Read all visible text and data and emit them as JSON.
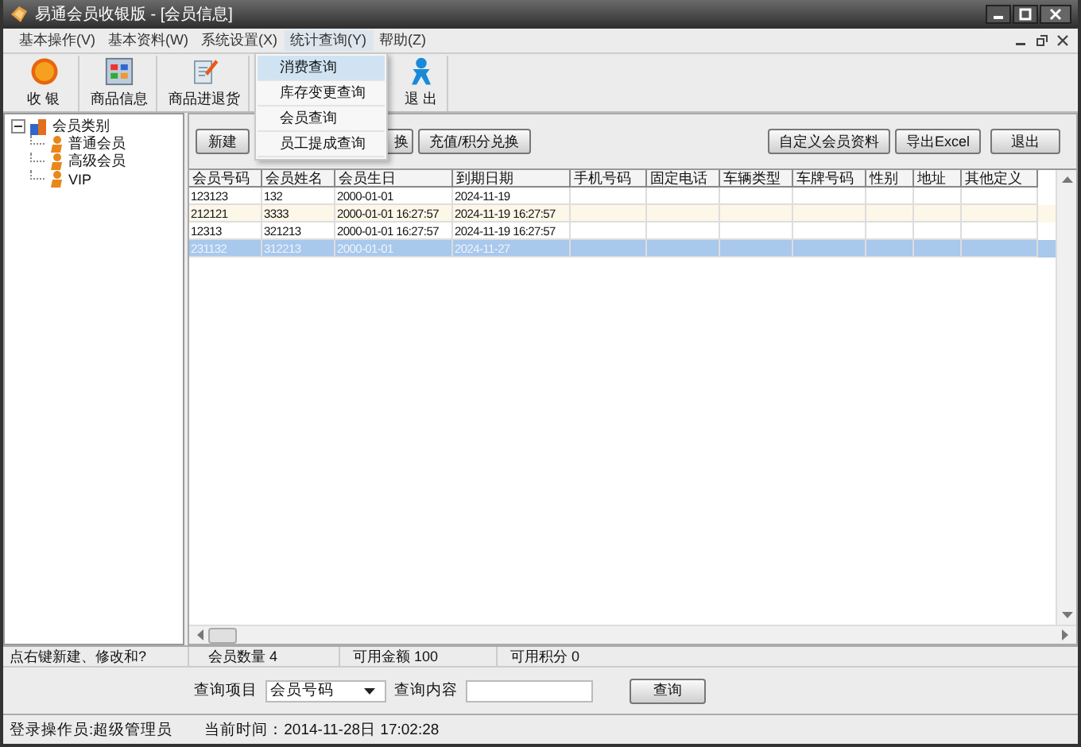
{
  "window": {
    "title": "易通会员收银版 - [会员信息]"
  },
  "menu": [
    {
      "label": "基本操作(V)",
      "selected": false
    },
    {
      "label": "基本资料(W)",
      "selected": false
    },
    {
      "label": "系统设置(X)",
      "selected": false
    },
    {
      "label": "统计查询(Y)",
      "selected": true
    },
    {
      "label": "帮助(Z)",
      "selected": false
    }
  ],
  "toolbar": [
    {
      "label": "收 银",
      "kind": "coin"
    },
    {
      "label": "商品信息",
      "kind": "grid"
    },
    {
      "label": "商品进退货",
      "kind": "document"
    },
    {
      "label": "退 出",
      "kind": "figure"
    }
  ],
  "dropdown": [
    {
      "label": "消费查询",
      "selected": true
    },
    {
      "label": "库存变更查询",
      "selected": false
    },
    {
      "label": "会员查询",
      "selected": false
    },
    {
      "label": "员工提成查询",
      "selected": false
    }
  ],
  "tree": {
    "label": "会员类别",
    "expanded": true,
    "children": [
      {
        "label": "普通会员"
      },
      {
        "label": "高级会员"
      },
      {
        "label": "VIP"
      }
    ]
  },
  "buttons_left": [
    "新建",
    "换",
    "充值/积分兑换"
  ],
  "buttons_right": [
    "自定义会员资料",
    "导出Excel",
    "退出"
  ],
  "table": {
    "columns": [
      "会员号码",
      "会员姓名",
      "会员生日",
      "到期日期",
      "手机号码",
      "固定电话",
      "车辆类型",
      "车牌号码",
      "性别",
      "地址",
      "其他定义"
    ],
    "rows": [
      {
        "cells": [
          "123123",
          "132",
          "2000-01-01",
          "2024-11-19"
        ],
        "selected": false
      },
      {
        "cells": [
          "212121",
          "3333",
          "2000-01-01 16:27:57",
          "2024-11-19 16:27:57"
        ],
        "selected": false
      },
      {
        "cells": [
          "12313",
          "321213",
          "2000-01-01 16:27:57",
          "2024-11-19 16:27:57"
        ],
        "selected": false
      },
      {
        "cells": [
          "231132",
          "312213",
          "2000-01-01",
          "2024-11-27"
        ],
        "selected": true
      }
    ]
  },
  "status_bar": [
    "点右键新建、修改和?",
    "会员数量 4",
    "可用金额 100",
    "可用积分 0"
  ],
  "search": {
    "item_label": "查询项目",
    "item_value": "会员号码",
    "content_label": "查询内容",
    "button": "查询"
  },
  "footer": {
    "operator": "登录操作员:超级管理员",
    "time": "当前时间：2014-11-28日 17:02:28"
  }
}
